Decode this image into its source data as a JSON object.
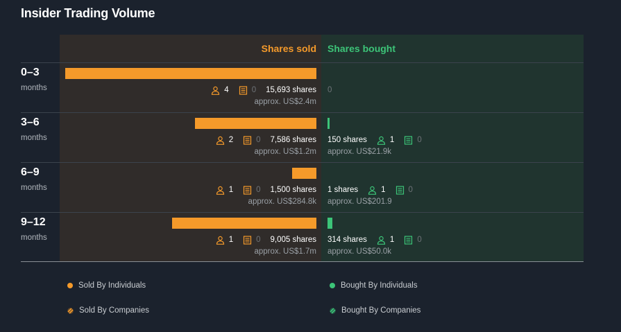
{
  "title": "Insider Trading Volume",
  "colors": {
    "sold": "#f59a2a",
    "bought": "#3cc478",
    "zero": "#6e7378"
  },
  "header": {
    "sold": "Shares sold",
    "bought": "Shares bought"
  },
  "chart_data": {
    "type": "bar",
    "categories": [
      "0–3",
      "3–6",
      "6–9",
      "9–12"
    ],
    "category_unit": "months",
    "series": [
      {
        "name": "Shares sold",
        "values": [
          15693,
          7586,
          1500,
          9005
        ]
      },
      {
        "name": "Shares bought",
        "values": [
          0,
          150,
          1,
          314
        ]
      }
    ]
  },
  "rows": [
    {
      "period": "0–3",
      "unit": "months",
      "sold": {
        "individuals": "4",
        "companies": "0",
        "shares": "15,693 shares",
        "approx": "approx. US$2.4m"
      },
      "bought": {
        "zero": "0"
      }
    },
    {
      "period": "3–6",
      "unit": "months",
      "sold": {
        "individuals": "2",
        "companies": "0",
        "shares": "7,586 shares",
        "approx": "approx. US$1.2m"
      },
      "bought": {
        "shares": "150 shares",
        "individuals": "1",
        "companies": "0",
        "approx": "approx. US$21.9k"
      }
    },
    {
      "period": "6–9",
      "unit": "months",
      "sold": {
        "individuals": "1",
        "companies": "0",
        "shares": "1,500 shares",
        "approx": "approx. US$284.8k"
      },
      "bought": {
        "shares": "1 shares",
        "individuals": "1",
        "companies": "0",
        "approx": "approx. US$201.9"
      }
    },
    {
      "period": "9–12",
      "unit": "months",
      "sold": {
        "individuals": "1",
        "companies": "0",
        "shares": "9,005 shares",
        "approx": "approx. US$1.7m"
      },
      "bought": {
        "shares": "314 shares",
        "individuals": "1",
        "companies": "0",
        "approx": "approx. US$50.0k"
      }
    }
  ],
  "legend": {
    "sold_individuals": "Sold By Individuals",
    "bought_individuals": "Bought By Individuals",
    "sold_companies": "Sold By Companies",
    "bought_companies": "Bought By Companies"
  }
}
